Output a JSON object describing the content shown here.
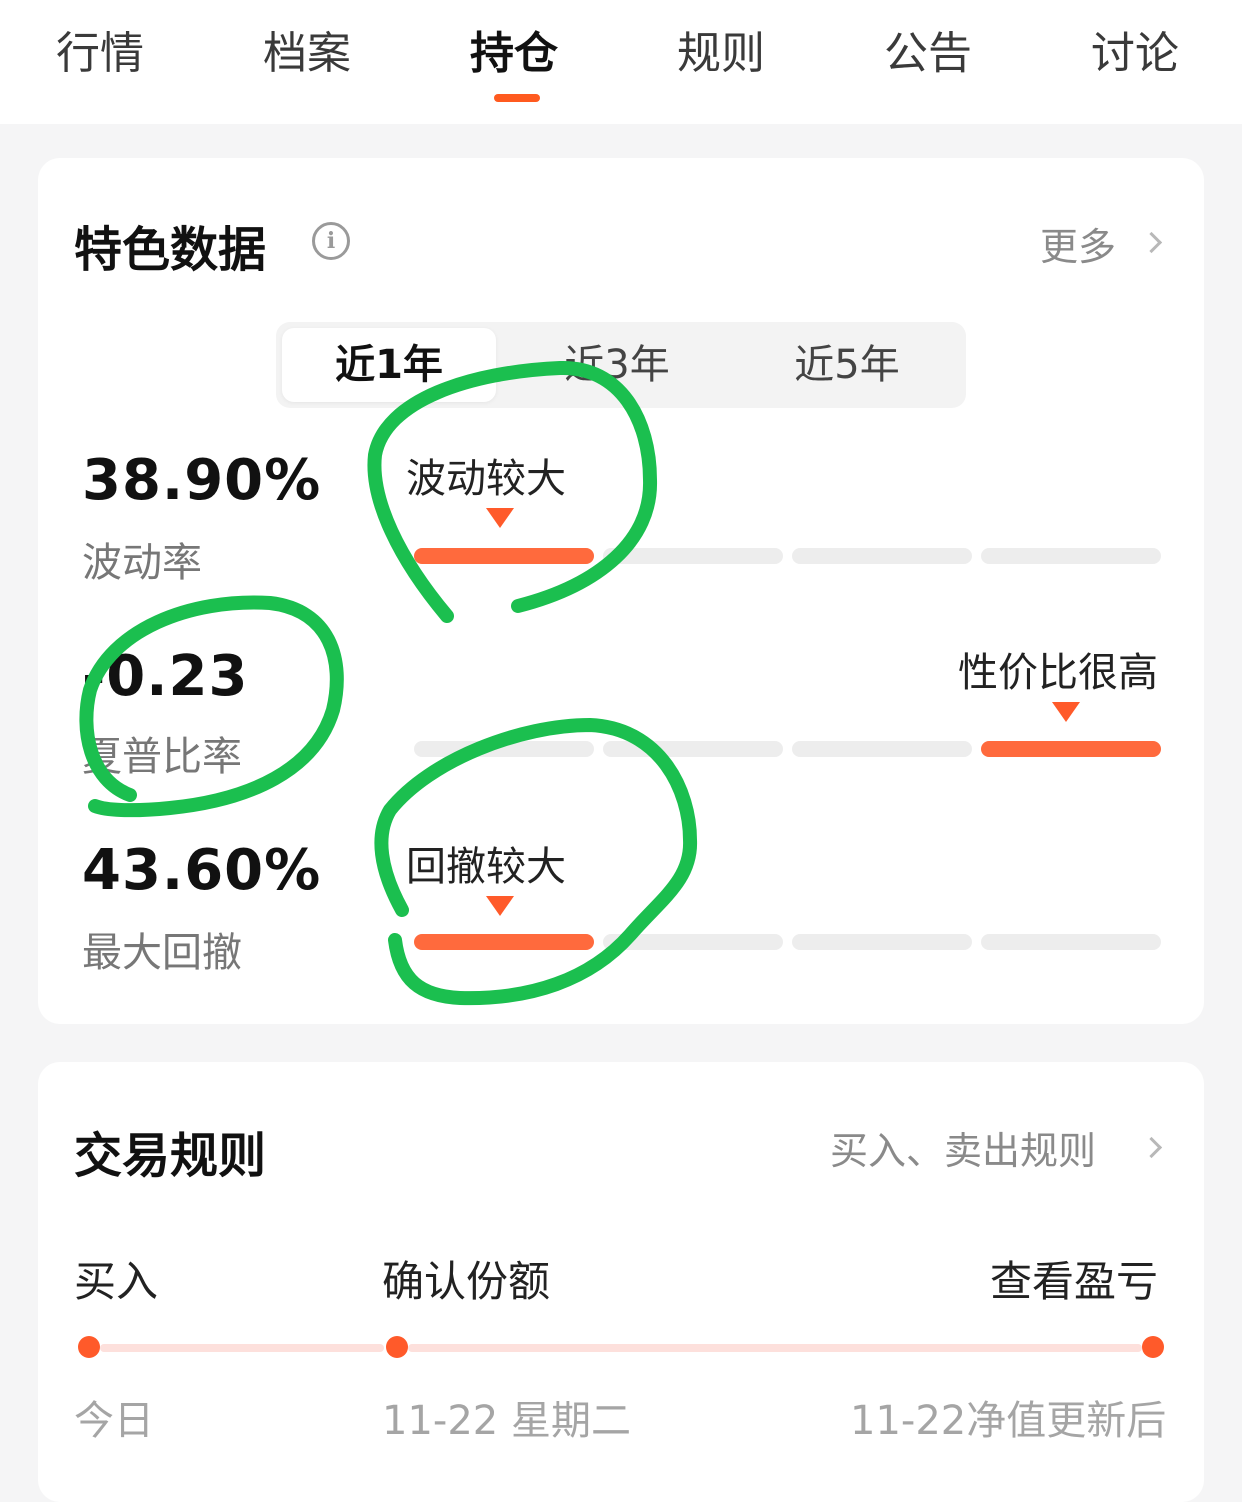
{
  "tabs": [
    {
      "label": "行情",
      "active": false
    },
    {
      "label": "档案",
      "active": false
    },
    {
      "label": "持仓",
      "active": true
    },
    {
      "label": "规则",
      "active": false
    },
    {
      "label": "公告",
      "active": false
    },
    {
      "label": "讨论",
      "active": false
    }
  ],
  "feature_card": {
    "title": "特色数据",
    "info_icon": "info-icon",
    "more_label": "更多",
    "periods": [
      "近1年",
      "近3年",
      "近5年"
    ],
    "selected_period": "近1年",
    "metrics": [
      {
        "value": "38.90%",
        "label": "波动率",
        "tag": "波动较大",
        "level_segment": 1,
        "segments": 4
      },
      {
        "value": "-0.23",
        "label": "夏普比率",
        "tag": "性价比很高",
        "level_segment": 4,
        "segments": 4
      },
      {
        "value": "43.60%",
        "label": "最大回撤",
        "tag": "回撤较大",
        "level_segment": 1,
        "segments": 4
      }
    ]
  },
  "rules_card": {
    "title": "交易规则",
    "link_label": "买入、卖出规则",
    "steps": [
      {
        "label": "买入",
        "sub": "今日"
      },
      {
        "label": "确认份额",
        "sub": "11-22 星期二"
      },
      {
        "label": "查看盈亏",
        "sub": "11-22净值更新后"
      }
    ]
  },
  "colors": {
    "accent": "#ff5a1f",
    "bar_active": "#ff6a3d",
    "bar_inactive": "#ededed",
    "annotation": "#1bbf4f"
  }
}
